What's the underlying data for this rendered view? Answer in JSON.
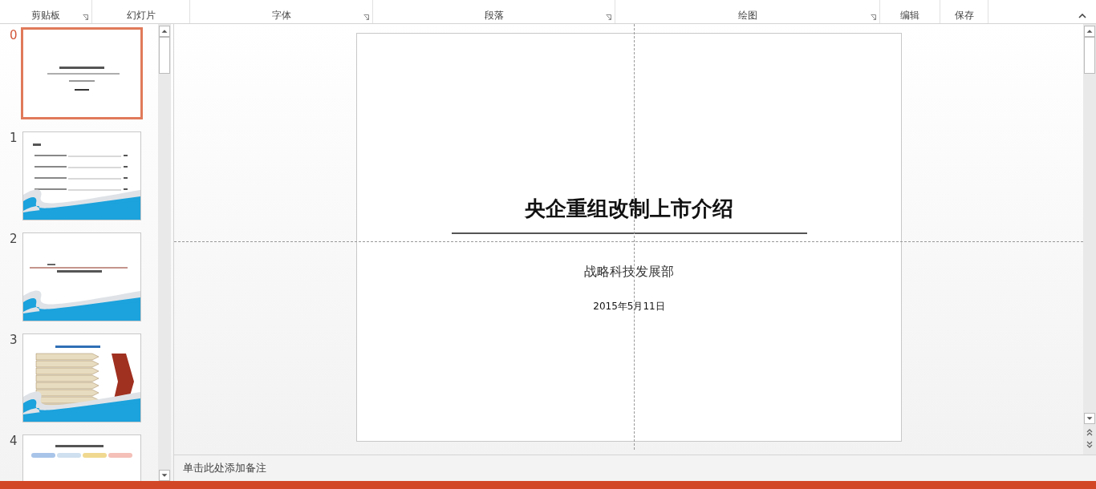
{
  "ribbon_groups": [
    {
      "label": "剪贴板",
      "launcher": true
    },
    {
      "label": "幻灯片",
      "launcher": false
    },
    {
      "label": "字体",
      "launcher": true
    },
    {
      "label": "段落",
      "launcher": true
    },
    {
      "label": "绘图",
      "launcher": true
    },
    {
      "label": "编辑",
      "launcher": false
    },
    {
      "label": "保存",
      "launcher": false
    }
  ],
  "slides": [
    {
      "number": "0",
      "selected": true,
      "kind": "title"
    },
    {
      "number": "1",
      "selected": false,
      "kind": "toc"
    },
    {
      "number": "2",
      "selected": false,
      "kind": "section"
    },
    {
      "number": "3",
      "selected": false,
      "kind": "diagram"
    },
    {
      "number": "4",
      "selected": false,
      "kind": "flow"
    }
  ],
  "slide": {
    "title": "央企重组改制上市介绍",
    "subtitle": "战略科技发展部",
    "date": "2015年5月11日"
  },
  "notes": {
    "prompt": "单击此处添加备注"
  }
}
